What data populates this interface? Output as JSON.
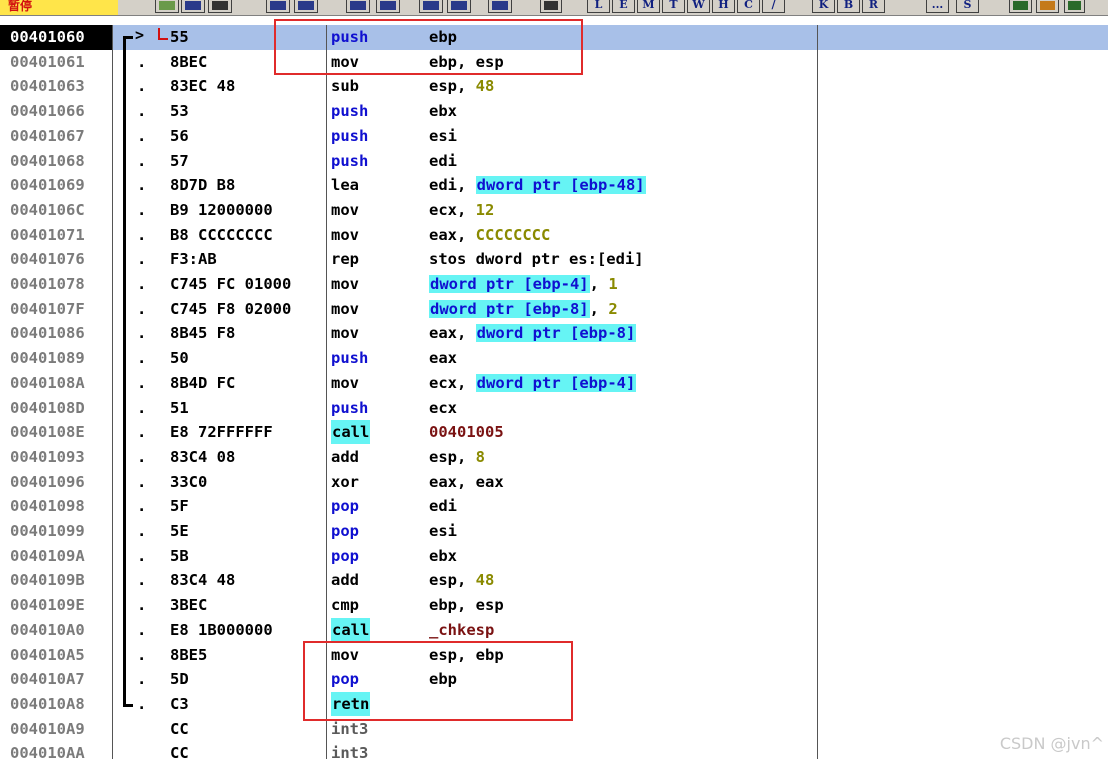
{
  "toolbar": {
    "status": "暂停",
    "letters": [
      "L",
      "E",
      "M",
      "T",
      "W",
      "H",
      "C",
      "/",
      "K",
      "B",
      "R",
      "...",
      "S"
    ]
  },
  "rows": [
    {
      "addr": "00401060",
      "dot": "",
      "hex": "55",
      "mn": "push",
      "ops": [
        {
          "t": "ebp",
          "c": "plain"
        }
      ],
      "sel": true
    },
    {
      "addr": "00401061",
      "dot": ".",
      "hex": "8BEC",
      "mn": "mov",
      "ops": [
        {
          "t": "ebp, esp",
          "c": "plain"
        }
      ]
    },
    {
      "addr": "00401063",
      "dot": ".",
      "hex": "83EC 48",
      "mn": "sub",
      "ops": [
        {
          "t": "esp, ",
          "c": "plain"
        },
        {
          "t": "48",
          "c": "num"
        }
      ]
    },
    {
      "addr": "00401066",
      "dot": ".",
      "hex": "53",
      "mn": "push",
      "ops": [
        {
          "t": "ebx",
          "c": "plain"
        }
      ]
    },
    {
      "addr": "00401067",
      "dot": ".",
      "hex": "56",
      "mn": "push",
      "ops": [
        {
          "t": "esi",
          "c": "plain"
        }
      ]
    },
    {
      "addr": "00401068",
      "dot": ".",
      "hex": "57",
      "mn": "push",
      "ops": [
        {
          "t": "edi",
          "c": "plain"
        }
      ]
    },
    {
      "addr": "00401069",
      "dot": ".",
      "hex": "8D7D B8",
      "mn": "lea",
      "ops": [
        {
          "t": "edi, ",
          "c": "plain"
        },
        {
          "t": "dword ptr [ebp-48]",
          "c": "hl"
        }
      ]
    },
    {
      "addr": "0040106C",
      "dot": ".",
      "hex": "B9 12000000",
      "mn": "mov",
      "ops": [
        {
          "t": "ecx, ",
          "c": "plain"
        },
        {
          "t": "12",
          "c": "num"
        }
      ]
    },
    {
      "addr": "00401071",
      "dot": ".",
      "hex": "B8 CCCCCCCC",
      "mn": "mov",
      "ops": [
        {
          "t": "eax, ",
          "c": "plain"
        },
        {
          "t": "CCCCCCCC",
          "c": "num"
        }
      ]
    },
    {
      "addr": "00401076",
      "dot": ".",
      "hex": "F3:AB",
      "mn": "rep",
      "ops": [
        {
          "t": "stos dword ptr es:[edi]",
          "c": "plain"
        }
      ]
    },
    {
      "addr": "00401078",
      "dot": ".",
      "hex": "C745 FC 01000",
      "mn": "mov",
      "ops": [
        {
          "t": "dword ptr [ebp-4]",
          "c": "hl"
        },
        {
          "t": ", ",
          "c": "plain"
        },
        {
          "t": "1",
          "c": "num"
        }
      ]
    },
    {
      "addr": "0040107F",
      "dot": ".",
      "hex": "C745 F8 02000",
      "mn": "mov",
      "ops": [
        {
          "t": "dword ptr [ebp-8]",
          "c": "hl"
        },
        {
          "t": ", ",
          "c": "plain"
        },
        {
          "t": "2",
          "c": "num"
        }
      ]
    },
    {
      "addr": "00401086",
      "dot": ".",
      "hex": "8B45 F8",
      "mn": "mov",
      "ops": [
        {
          "t": "eax, ",
          "c": "plain"
        },
        {
          "t": "dword ptr [ebp-8]",
          "c": "hl"
        }
      ]
    },
    {
      "addr": "00401089",
      "dot": ".",
      "hex": "50",
      "mn": "push",
      "ops": [
        {
          "t": "eax",
          "c": "plain"
        }
      ]
    },
    {
      "addr": "0040108A",
      "dot": ".",
      "hex": "8B4D FC",
      "mn": "mov",
      "ops": [
        {
          "t": "ecx, ",
          "c": "plain"
        },
        {
          "t": "dword ptr [ebp-4]",
          "c": "hl"
        }
      ]
    },
    {
      "addr": "0040108D",
      "dot": ".",
      "hex": "51",
      "mn": "push",
      "ops": [
        {
          "t": "ecx",
          "c": "plain"
        }
      ]
    },
    {
      "addr": "0040108E",
      "dot": ".",
      "hex": "E8 72FFFFFF",
      "mn": "call",
      "ops": [
        {
          "t": "00401005",
          "c": "target"
        }
      ]
    },
    {
      "addr": "00401093",
      "dot": ".",
      "hex": "83C4 08",
      "mn": "add",
      "ops": [
        {
          "t": "esp, ",
          "c": "plain"
        },
        {
          "t": "8",
          "c": "num"
        }
      ]
    },
    {
      "addr": "00401096",
      "dot": ".",
      "hex": "33C0",
      "mn": "xor",
      "ops": [
        {
          "t": "eax, eax",
          "c": "plain"
        }
      ]
    },
    {
      "addr": "00401098",
      "dot": ".",
      "hex": "5F",
      "mn": "pop",
      "ops": [
        {
          "t": "edi",
          "c": "plain"
        }
      ]
    },
    {
      "addr": "00401099",
      "dot": ".",
      "hex": "5E",
      "mn": "pop",
      "ops": [
        {
          "t": "esi",
          "c": "plain"
        }
      ]
    },
    {
      "addr": "0040109A",
      "dot": ".",
      "hex": "5B",
      "mn": "pop",
      "ops": [
        {
          "t": "ebx",
          "c": "plain"
        }
      ]
    },
    {
      "addr": "0040109B",
      "dot": ".",
      "hex": "83C4 48",
      "mn": "add",
      "ops": [
        {
          "t": "esp, ",
          "c": "plain"
        },
        {
          "t": "48",
          "c": "num"
        }
      ]
    },
    {
      "addr": "0040109E",
      "dot": ".",
      "hex": "3BEC",
      "mn": "cmp",
      "ops": [
        {
          "t": "ebp, esp",
          "c": "plain"
        }
      ]
    },
    {
      "addr": "004010A0",
      "dot": ".",
      "hex": "E8 1B000000",
      "mn": "call",
      "ops": [
        {
          "t": "_chkesp",
          "c": "target"
        }
      ]
    },
    {
      "addr": "004010A5",
      "dot": ".",
      "hex": "8BE5",
      "mn": "mov",
      "ops": [
        {
          "t": "esp, ebp",
          "c": "plain"
        }
      ]
    },
    {
      "addr": "004010A7",
      "dot": ".",
      "hex": "5D",
      "mn": "pop",
      "ops": [
        {
          "t": "ebp",
          "c": "plain"
        }
      ]
    },
    {
      "addr": "004010A8",
      "dot": ".",
      "hex": "C3",
      "mn": "retn",
      "ops": []
    },
    {
      "addr": "004010A9",
      "dot": "",
      "hex": "CC",
      "mn": "int3",
      "ops": []
    },
    {
      "addr": "004010AA",
      "dot": "",
      "hex": "CC",
      "mn": "int3",
      "ops": []
    }
  ],
  "watermark": "CSDN @jvn^"
}
